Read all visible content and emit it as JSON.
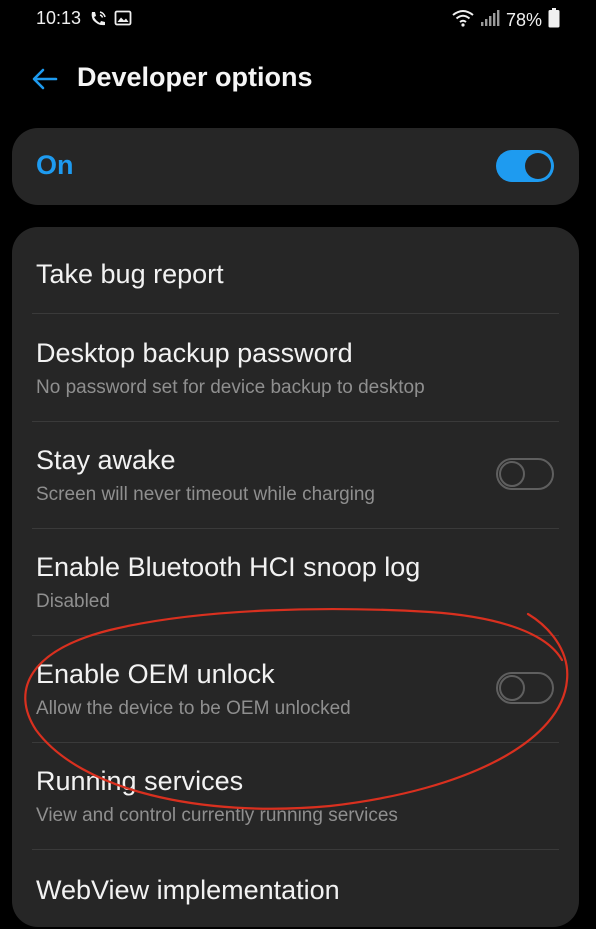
{
  "status_bar": {
    "time": "10:13",
    "left_icons": [
      "wifi-call-icon",
      "image-icon"
    ],
    "battery": "78%",
    "right_icons": [
      "wifi-icon",
      "signal-icon",
      "battery-icon"
    ]
  },
  "header": {
    "title": "Developer options",
    "back_icon": "back-arrow-icon"
  },
  "master": {
    "label": "On",
    "enabled": true
  },
  "settings": [
    {
      "title": "Take bug report",
      "subtitle": ""
    },
    {
      "title": "Desktop backup password",
      "subtitle": "No password set for device backup to desktop"
    },
    {
      "title": "Stay awake",
      "subtitle": "Screen will never timeout while charging",
      "toggle": false
    },
    {
      "title": "Enable Bluetooth HCI snoop log",
      "subtitle": "Disabled"
    },
    {
      "title": "Enable OEM unlock",
      "subtitle": "Allow the device to be OEM unlocked",
      "toggle": false
    },
    {
      "title": "Running services",
      "subtitle": "View and control currently running services"
    },
    {
      "title": "WebView implementation",
      "subtitle": ""
    }
  ],
  "colors": {
    "accent": "#1e9bf0",
    "card": "#262626",
    "background": "#000000",
    "annotation": "#d9301f"
  }
}
